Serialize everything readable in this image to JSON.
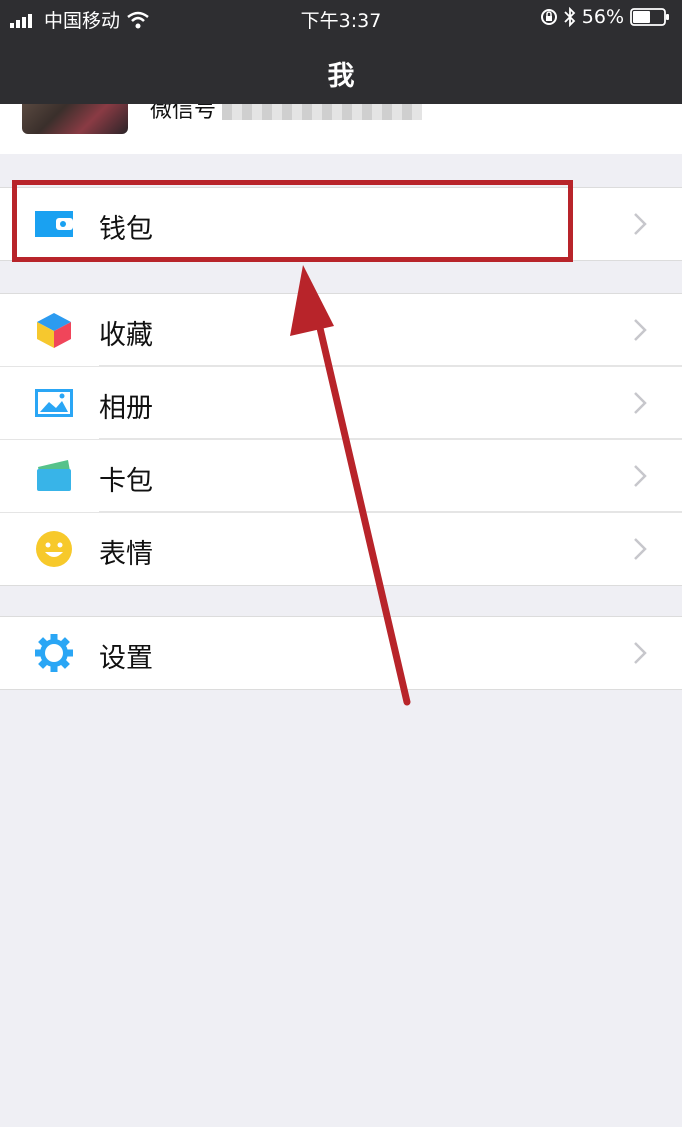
{
  "status": {
    "carrier": "中国移动",
    "time": "下午3:37",
    "battery": "56%"
  },
  "header": {
    "title": "我"
  },
  "profile": {
    "wechat_id": "微信号"
  },
  "sections": [
    {
      "items": [
        {
          "label": "钱包",
          "icon": "wallet-icon"
        }
      ]
    },
    {
      "items": [
        {
          "label": "收藏",
          "icon": "favorites-cube-icon"
        },
        {
          "label": "相册",
          "icon": "album-picture-icon"
        },
        {
          "label": "卡包",
          "icon": "card-wallet-icon"
        },
        {
          "label": "表情",
          "icon": "smiley-face-icon"
        }
      ]
    },
    {
      "items": [
        {
          "label": "设置",
          "icon": "gear-icon"
        }
      ]
    }
  ],
  "colors": {
    "header_bg": "#2e2e31",
    "page_bg": "#efeff4",
    "accent_blue": "#1aa1f1",
    "annotation_red": "#b8242a"
  }
}
